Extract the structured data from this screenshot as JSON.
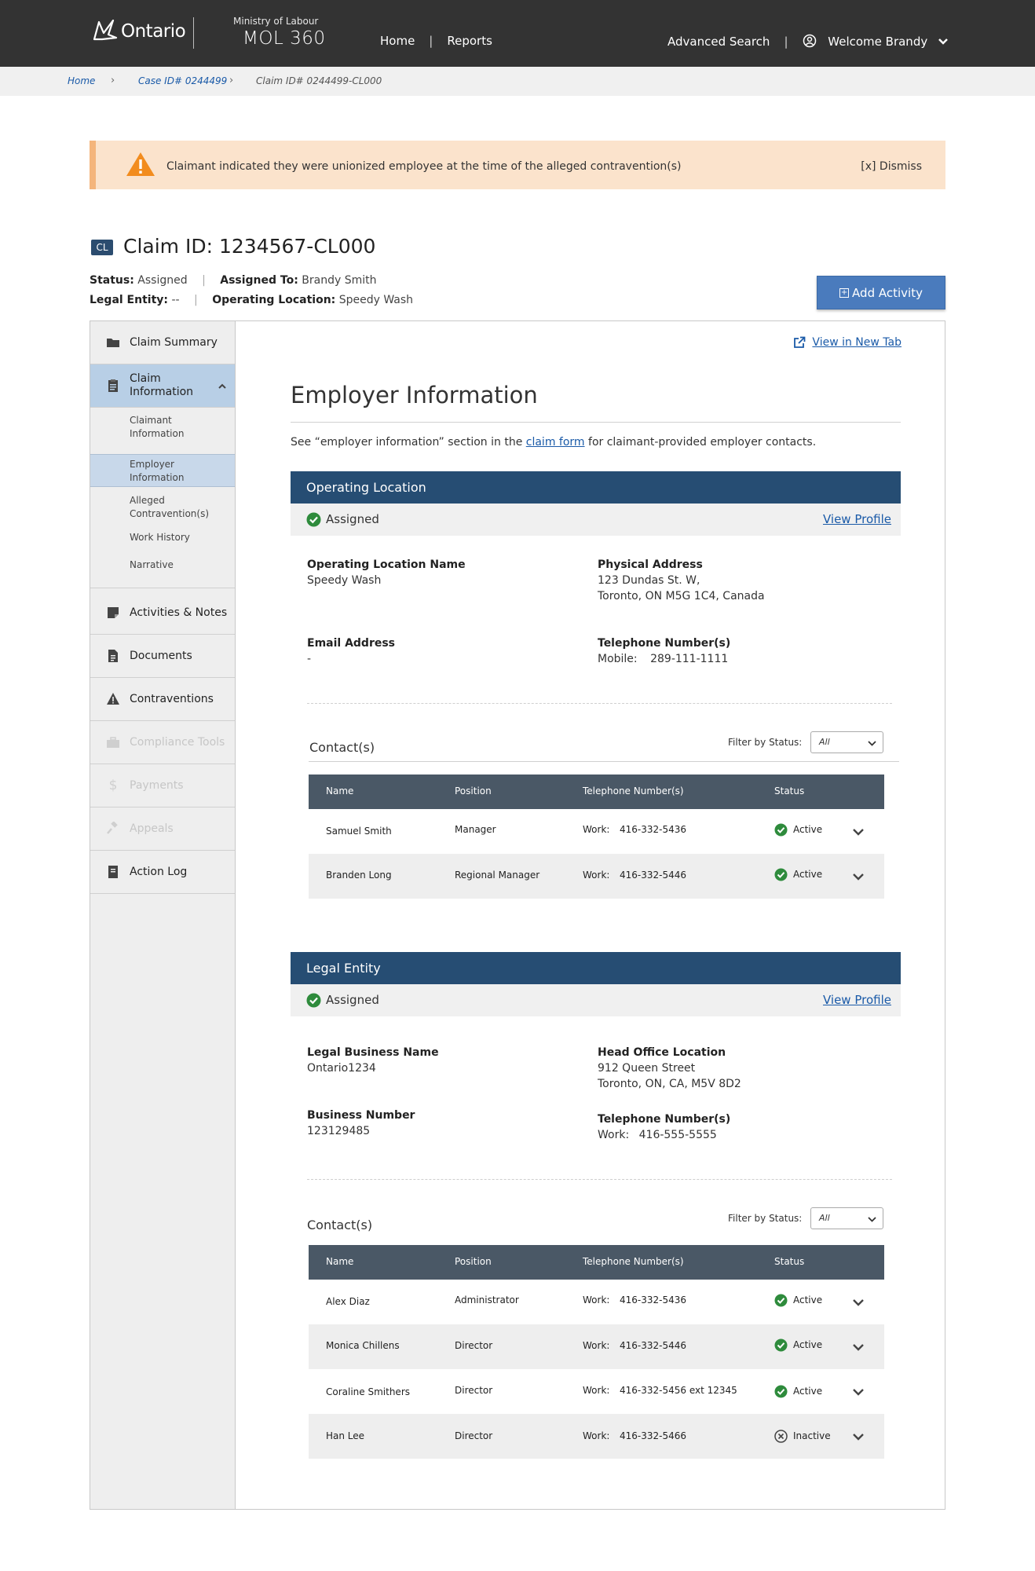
{
  "header": {
    "logo_text": "Ontario",
    "ministry": "Ministry of Labour",
    "app_name": "MOL 360",
    "nav": [
      "Home",
      "Reports"
    ],
    "advanced_search": "Advanced Search",
    "welcome": "Welcome Brandy"
  },
  "breadcrumb": {
    "home": "Home",
    "case": "Case ID# 0244499",
    "claim": "Claim ID# 0244499-CL000"
  },
  "alert": {
    "message": "Claimant indicated they were unionized employee at the time of the alleged contravention(s)",
    "dismiss": "[x] Dismiss"
  },
  "claim": {
    "badge": "CL",
    "title": "Claim ID: 1234567-CL000",
    "status_label": "Status:",
    "status_value": "Assigned",
    "assigned_label": "Assigned To:",
    "assigned_value": "Brandy Smith",
    "legal_label": "Legal Entity:",
    "legal_value": "--",
    "oploc_label": "Operating Location:",
    "oploc_value": "Speedy Wash",
    "add_activity": "Add Activity"
  },
  "sidebar": {
    "claim_summary": "Claim Summary",
    "claim_information": "Claim Information",
    "sub_claimant": "Claimant Information",
    "sub_employer": "Employer Information",
    "sub_alleged": "Alleged Contravention(s)",
    "sub_work": "Work History",
    "sub_narrative": "Narrative",
    "activities": "Activities & Notes",
    "documents": "Documents",
    "contraventions": "Contraventions",
    "compliance": "Compliance Tools",
    "payments": "Payments",
    "appeals": "Appeals",
    "action_log": "Action Log"
  },
  "main": {
    "view_new_tab": "View in New Tab",
    "title": "Employer Information",
    "intro_before": "See “employer information” section in the",
    "intro_link": "claim form",
    "intro_after": "for claimant-provided employer contacts."
  },
  "operating": {
    "heading": "Operating Location",
    "status": "Assigned",
    "view_profile": "View Profile",
    "name_label": "Operating Location Name",
    "name_value": "Speedy Wash",
    "address_label": "Physical Address",
    "address_line1": "123 Dundas St. W,",
    "address_line2": "Toronto, ON M5G 1C4, Canada",
    "email_label": "Email Address",
    "email_value": "-",
    "phone_label": "Telephone Number(s)",
    "phone_type": "Mobile:",
    "phone_value": "289-111-1111",
    "contacts_title": "Contact(s)",
    "filter_label": "Filter by Status:",
    "filter_value": "All",
    "columns": [
      "Name",
      "Position",
      "Telephone Number(s)",
      "Status"
    ],
    "rows": [
      {
        "name": "Samuel Smith",
        "position": "Manager",
        "phone_type": "Work:",
        "phone": "416-332-5436",
        "status": "Active"
      },
      {
        "name": "Branden Long",
        "position": "Regional Manager",
        "phone_type": "Work:",
        "phone": "416-332-5446",
        "status": "Active"
      }
    ]
  },
  "legal": {
    "heading": "Legal Entity",
    "status": "Assigned",
    "view_profile": "View Profile",
    "name_label": "Legal Business Name",
    "name_value": "Ontario1234",
    "office_label": "Head Office Location",
    "office_line1": "912 Queen Street",
    "office_line2": "Toronto, ON, CA, M5V 8D2",
    "bn_label": "Business Number",
    "bn_value": "123129485",
    "phone_label": "Telephone Number(s)",
    "phone_type": "Work:",
    "phone_value": "416-555-5555",
    "contacts_title": "Contact(s)",
    "filter_label": "Filter by Status:",
    "filter_value": "All",
    "columns": [
      "Name",
      "Position",
      "Telephone Number(s)",
      "Status"
    ],
    "rows": [
      {
        "name": "Alex Diaz",
        "position": "Administrator",
        "phone_type": "Work:",
        "phone": "416-332-5436",
        "status": "Active"
      },
      {
        "name": "Monica Chillens",
        "position": "Director",
        "phone_type": "Work:",
        "phone": "416-332-5446",
        "status": "Active"
      },
      {
        "name": "Coraline Smithers",
        "position": "Director",
        "phone_type": "Work:",
        "phone": "416-332-5456 ext 12345",
        "status": "Active"
      },
      {
        "name": "Han Lee",
        "position": "Director",
        "phone_type": "Work:",
        "phone": "416-332-5466",
        "status": "Inactive"
      }
    ]
  },
  "colors": {
    "header_bg": "#333333",
    "section_blue": "#264d73",
    "table_head": "#4a5866",
    "link": "#1a5aa8",
    "active_green": "#2e8b3c",
    "alert_bg": "#fbe3cc",
    "alert_icon": "#f28c1e"
  }
}
